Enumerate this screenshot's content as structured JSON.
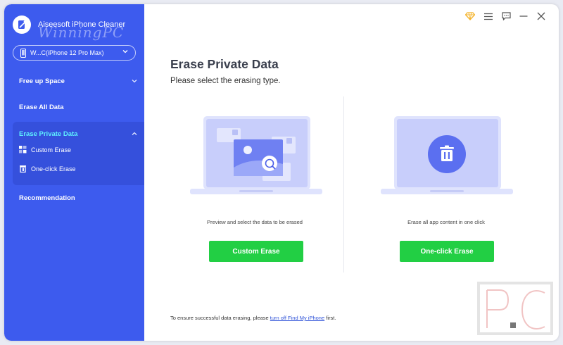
{
  "app": {
    "title": "Aiseesoft iPhone Cleaner",
    "watermark": "WinningPC"
  },
  "device": {
    "name": "W...C(iPhone 12 Pro Max)"
  },
  "sidebar": {
    "items": [
      {
        "label": "Free up Space",
        "expanded": false
      },
      {
        "label": "Erase All Data"
      },
      {
        "label": "Erase Private Data",
        "expanded": true,
        "active": true
      },
      {
        "label": "Recommendation"
      }
    ],
    "subitems": [
      {
        "label": "Custom Erase",
        "icon": "grid-icon"
      },
      {
        "label": "One-click Erase",
        "icon": "trash-icon"
      }
    ]
  },
  "main": {
    "title": "Erase Private Data",
    "subtitle": "Please select the erasing type.",
    "options": [
      {
        "caption": "Preview and select the data to be erased",
        "button": "Custom Erase"
      },
      {
        "caption": "Erase all app content in one click",
        "button": "One-click Erase"
      }
    ],
    "footer": {
      "prefix": "To ensure successful data erasing, please ",
      "link": "turn off Find My iPhone",
      "suffix": " first."
    }
  },
  "colors": {
    "sidebar": "#3d5bee",
    "accent_text": "#5ef0ff",
    "button": "#22cf44",
    "premium": "#f4b32b"
  },
  "corner_mark": "P.C"
}
